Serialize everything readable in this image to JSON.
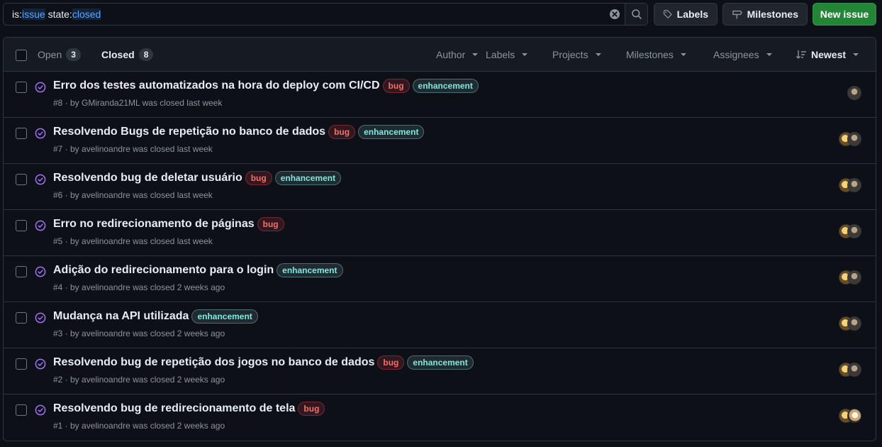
{
  "search": {
    "qualifier1": "is:",
    "value1": "issue",
    "qualifier2": " state:",
    "value2": "closed"
  },
  "toolbar": {
    "labels_label": "Labels",
    "milestones_label": "Milestones",
    "new_issue_label": "New issue"
  },
  "header": {
    "open_label": "Open",
    "open_count": "3",
    "closed_label": "Closed",
    "closed_count": "8",
    "filters": {
      "author": "Author",
      "labels": "Labels",
      "projects": "Projects",
      "milestones": "Milestones",
      "assignees": "Assignees",
      "sort": "Newest"
    }
  },
  "issues": [
    {
      "title": "Erro dos testes automatizados na hora do deploy com CI/CD",
      "labels": [
        "bug",
        "enhancement"
      ],
      "meta": "#8 · by GMiranda21ML was closed last week",
      "avatars": [
        "g"
      ]
    },
    {
      "title": "Resolvendo Bugs de repetição no banco de dados",
      "labels": [
        "bug",
        "enhancement"
      ],
      "meta": "#7 · by avelinoandre was closed last week",
      "avatars": [
        "a",
        "g"
      ]
    },
    {
      "title": "Resolvendo bug de deletar usuário",
      "labels": [
        "bug",
        "enhancement"
      ],
      "meta": "#6 · by avelinoandre was closed last week",
      "avatars": [
        "a",
        "g"
      ]
    },
    {
      "title": "Erro no redirecionamento de páginas",
      "labels": [
        "bug"
      ],
      "meta": "#5 · by avelinoandre was closed last week",
      "avatars": [
        "a",
        "g"
      ]
    },
    {
      "title": "Adição do redirecionamento para o login",
      "labels": [
        "enhancement"
      ],
      "meta": "#4 · by avelinoandre was closed 2 weeks ago",
      "avatars": [
        "a",
        "g"
      ]
    },
    {
      "title": "Mudança na API utilizada",
      "labels": [
        "enhancement"
      ],
      "meta": "#3 · by avelinoandre was closed 2 weeks ago",
      "avatars": [
        "a",
        "g"
      ]
    },
    {
      "title": "Resolvendo bug de repetição dos jogos no banco de dados",
      "labels": [
        "bug",
        "enhancement"
      ],
      "meta": "#2 · by avelinoandre was closed 2 weeks ago",
      "avatars": [
        "a",
        "g"
      ]
    },
    {
      "title": "Resolvendo bug de redirecionamento de tela",
      "labels": [
        "bug"
      ],
      "meta": "#1 · by avelinoandre was closed 2 weeks ago",
      "avatars": [
        "a",
        "a2"
      ]
    }
  ],
  "icons": {
    "row_icon": "issue-closed-check-icon",
    "clear": "clear-x-icon",
    "search": "search-icon",
    "labels": "tag-icon",
    "milestones": "milestone-icon",
    "sort": "sort-icon"
  },
  "colors": {
    "background": "#0d1117",
    "header_bg": "#161b22",
    "border": "#30363d",
    "closed_purple": "#a371f7",
    "new_issue_green": "#238636",
    "bug_red": "#f47067",
    "enhancement_teal": "#7ee8e0"
  }
}
